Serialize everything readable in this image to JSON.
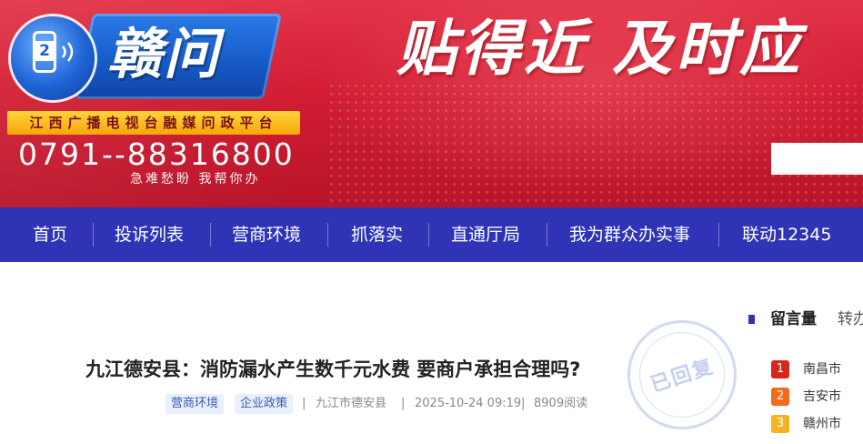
{
  "banner": {
    "logo_digit": "2",
    "logo_text": "赣问",
    "subtitle": "江西广播电视台融媒问政平台",
    "hotline": "0791--88316800",
    "hotline_note": "急难愁盼  我帮你办",
    "slogan": "贴得近  及时应",
    "search_placeholder": ""
  },
  "nav": {
    "items": [
      {
        "label": "首页"
      },
      {
        "label": "投诉列表"
      },
      {
        "label": "营商环境"
      },
      {
        "label": "抓落实"
      },
      {
        "label": "直通厅局"
      },
      {
        "label": "我为群众办实事"
      },
      {
        "label": "联动12345"
      }
    ]
  },
  "article": {
    "title": "九江德安县：消防漏水产生数千元水费 要商户承担合理吗?",
    "tags": [
      "营商环境",
      "企业政策"
    ],
    "location": "九江市德安县",
    "datetime": "2025-10-24 09:19",
    "reads": "8909阅读",
    "separator": "|",
    "stamp": "已回复"
  },
  "ranking": {
    "tab_active": "留言量",
    "tab_other": "转办",
    "items": [
      {
        "rank": "1",
        "name": "南昌市",
        "color": "#d9261c"
      },
      {
        "rank": "2",
        "name": "吉安市",
        "color": "#f26b1d"
      },
      {
        "rank": "3",
        "name": "赣州市",
        "color": "#f5b323"
      }
    ]
  },
  "colors": {
    "banner_red": "#d21d33",
    "nav_blue": "#2f33b5",
    "logo_blue": "#1659c7",
    "subtitle_gold": "#f6a60a",
    "tag_bg": "#e9effb",
    "tag_text": "#3a5bb8"
  }
}
